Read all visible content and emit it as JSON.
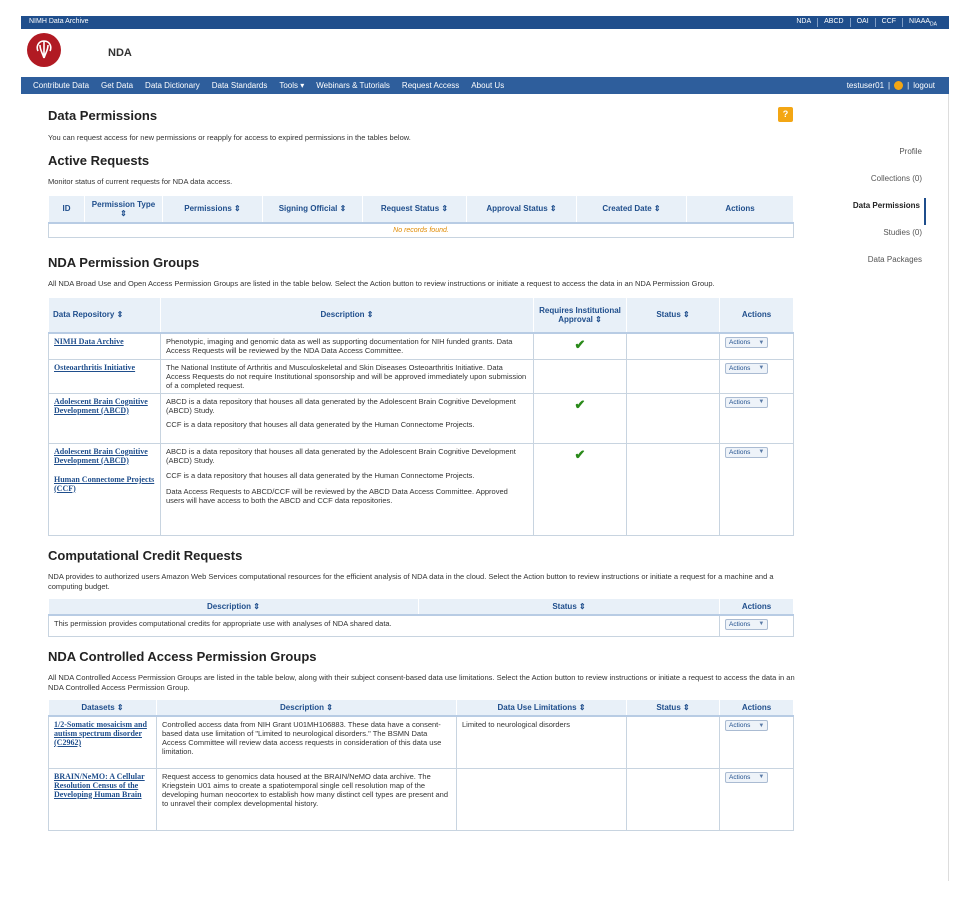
{
  "header": {
    "brand": "NIMH Data Archive",
    "top_links": [
      "NDA",
      "ABCD",
      "OAI",
      "CCF",
      "NIAAA"
    ],
    "top_links_last_sub": "DA",
    "site_name": "NDA"
  },
  "nav": {
    "items": [
      "Contribute Data",
      "Get Data",
      "Data Dictionary",
      "Data Standards",
      "Tools ▾",
      "Webinars & Tutorials",
      "Request Access",
      "About Us"
    ],
    "user": "testuser01",
    "logout": "logout"
  },
  "page": {
    "title": "Data Permissions",
    "help_label": "?",
    "intro": "You can request access for new permissions or reapply for access to expired permissions in the tables below."
  },
  "active_requests": {
    "title": "Active Requests",
    "note": "Monitor status of current requests for NDA data access.",
    "columns": [
      "ID",
      "Permission Type ⇕",
      "Permissions ⇕",
      "Signing Official ⇕",
      "Request Status ⇕",
      "Approval Status ⇕",
      "Created Date ⇕",
      "Actions"
    ],
    "empty": "No records found."
  },
  "permission_groups": {
    "title": "NDA Permission Groups",
    "note": "All NDA Broad Use and Open Access Permission Groups are listed in the table below.  Select the Action button to review instructions or initiate a request to access the data in an NDA Permission Group.",
    "columns": [
      "Data Repository ⇕",
      "Description ⇕",
      "Requires Institutional Approval ⇕",
      "Status ⇕",
      "Actions"
    ],
    "rows": [
      {
        "repo": "NIMH Data Archive",
        "desc": "Phenotypic, imaging and genomic data as well as supporting documentation for NIH funded grants. Data Access Requests will be reviewed by the NDA Data Access Committee."
      },
      {
        "repo": "Osteoarthritis Initiative",
        "desc": "The National Institute of Arthritis and Musculoskeletal and Skin Diseases Osteoarthritis Initiative. Data Access Requests do not require Institutional sponsorship and will be approved immediately upon submission of a completed request."
      },
      {
        "repo": "Adolescent Brain Cognitive Development (ABCD)",
        "desc": "ABCD is a data repository that houses all data generated by the Adolescent Brain Cognitive Development (ABCD) Study.",
        "desc2": "CCF is a data repository that houses all data generated by the Human Connectome Projects."
      },
      {
        "repo": "Adolescent Brain Cognitive Development (ABCD)",
        "repo2": "Human Connectome Projects (CCF)",
        "desc": "ABCD is a data repository that houses all data generated by the Adolescent Brain Cognitive Development (ABCD) Study.",
        "desc2": "CCF is a data repository that houses all data generated by the Human Connectome Projects.",
        "desc3": "Data Access Requests to ABCD/CCF will be reviewed by the ABCD Data Access Committee. Approved users will have access to both the ABCD and CCF data repositories."
      }
    ],
    "action_label": "Actions"
  },
  "computational": {
    "title": "Computational Credit Requests",
    "note": "NDA provides to authorized users Amazon Web Services computational resources for the efficient analysis of NDA data in the cloud.  Select the Action button to review instructions or initiate a request for a machine and a computing budget.",
    "columns": [
      "Description ⇕",
      "Status ⇕",
      "Actions"
    ],
    "row_desc": "This permission provides computational credits for appropriate use with analyses of NDA shared data."
  },
  "controlled": {
    "title": "NDA Controlled Access Permission Groups",
    "note": "All NDA Controlled Access Permission Groups are listed in the table below, along with their subject consent-based data use limitations.  Select the Action button to review instructions or initiate a request to access the data in an NDA Controlled Access Permission Group.",
    "columns": [
      "Datasets ⇕",
      "Description ⇕",
      "Data Use Limitations ⇕",
      "Status ⇕",
      "Actions"
    ],
    "rows": [
      {
        "dataset": "1/2-Somatic mosaicism and autism spectrum disorder (C2962)",
        "desc": "Controlled access data from NIH Grant U01MH106883. These data have a consent-based data use limitation of \"Limited to neurological disorders.\" The BSMN Data Access Committee will review data access requests in consideration of this data use limitation.",
        "limit": "Limited to neurological disorders"
      },
      {
        "dataset": "BRAIN/NeMO: A Cellular Resolution Census of the Developing Human Brain",
        "desc": "Request access to genomics data housed at the BRAIN/NeMO data archive. The Kriegstein U01 aims to create a spatiotemporal single cell resolution map of the developing human neocortex to establish how many distinct cell types are present and to unravel their complex developmental history.",
        "limit": ""
      }
    ]
  },
  "sidenav": {
    "items": [
      "Profile",
      "Collections (0)",
      "Data Permissions",
      "Studies (0)",
      "Data Packages"
    ]
  }
}
